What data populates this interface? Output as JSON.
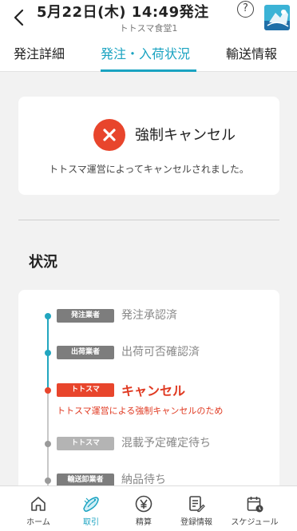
{
  "header": {
    "title": "5月22日(木) 14:49発注",
    "subtitle": "トトスマ食堂1",
    "help_label": "?"
  },
  "tabs": [
    {
      "label": "発注詳細",
      "active": false
    },
    {
      "label": "発注・入荷状況",
      "active": true
    },
    {
      "label": "輸送情報",
      "active": false
    }
  ],
  "cancel_card": {
    "title": "強制キャンセル",
    "description": "トトスマ運営によってキャンセルされました。"
  },
  "status": {
    "section_title": "状況",
    "steps": [
      {
        "tag": "発注業者",
        "label": "発注承認済",
        "state": "done"
      },
      {
        "tag": "出荷業者",
        "label": "出荷可否確認済",
        "state": "done"
      },
      {
        "tag": "トトスマ",
        "label": "キャンセル",
        "state": "cancelled",
        "note": "トトスマ運営による強制キャンセルのため"
      },
      {
        "tag": "トトスマ",
        "label": "混載予定確定待ち",
        "state": "pending"
      },
      {
        "tag": "輸送卸業者",
        "label": "納品待ち",
        "state": "pending"
      }
    ]
  },
  "bottom_nav": [
    {
      "label": "ホーム",
      "icon": "home-icon",
      "active": false
    },
    {
      "label": "取引",
      "icon": "trade-icon",
      "active": true
    },
    {
      "label": "精算",
      "icon": "yen-icon",
      "active": false
    },
    {
      "label": "登録情報",
      "icon": "registration-icon",
      "active": false
    },
    {
      "label": "スケジュール",
      "icon": "calendar-icon",
      "active": false
    }
  ],
  "colors": {
    "accent": "#1aa3c1",
    "cancel_red": "#e8452c",
    "done_tag": "#7d7d7d",
    "pending_tag": "#b4b4b4"
  }
}
